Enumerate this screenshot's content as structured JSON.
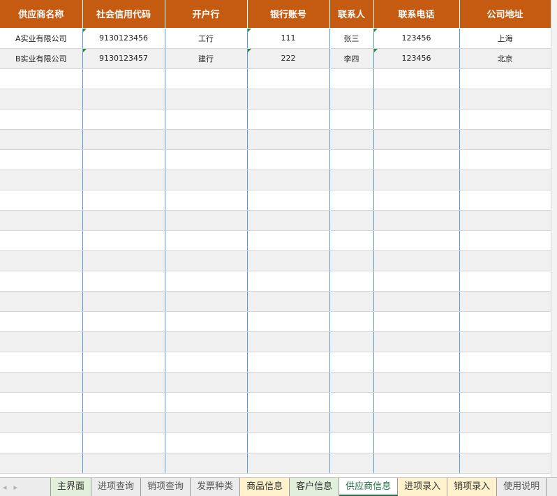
{
  "sheet": {
    "columns": [
      "供应商名称",
      "社会信用代码",
      "开户行",
      "银行账号",
      "联系人",
      "联系电话",
      "公司地址"
    ],
    "rows": [
      [
        "A实业有限公司",
        "9130123456",
        "工行",
        "111",
        "张三",
        "123456",
        "上海"
      ],
      [
        "B实业有限公司",
        "9130123457",
        "建行",
        "222",
        "李四",
        "123456",
        "北京"
      ]
    ],
    "empty_row_count": 20
  },
  "tabs": [
    {
      "label": "主界面",
      "style": "green"
    },
    {
      "label": "进项查询",
      "style": "plain"
    },
    {
      "label": "销项查询",
      "style": "plain"
    },
    {
      "label": "发票种类",
      "style": "plain"
    },
    {
      "label": "商品信息",
      "style": "yellow"
    },
    {
      "label": "客户信息",
      "style": "green"
    },
    {
      "label": "供应商信息",
      "style": "active"
    },
    {
      "label": "进项录入",
      "style": "yellow"
    },
    {
      "label": "销项录入",
      "style": "yellow"
    },
    {
      "label": "使用说明",
      "style": "plain"
    }
  ],
  "nav": {
    "prev": "◂",
    "next": "▸"
  },
  "colors": {
    "header_bg": "#C55A11",
    "active_tab": "#217346",
    "green_tab": "#E2EFDA",
    "yellow_tab": "#FFF2CC"
  }
}
